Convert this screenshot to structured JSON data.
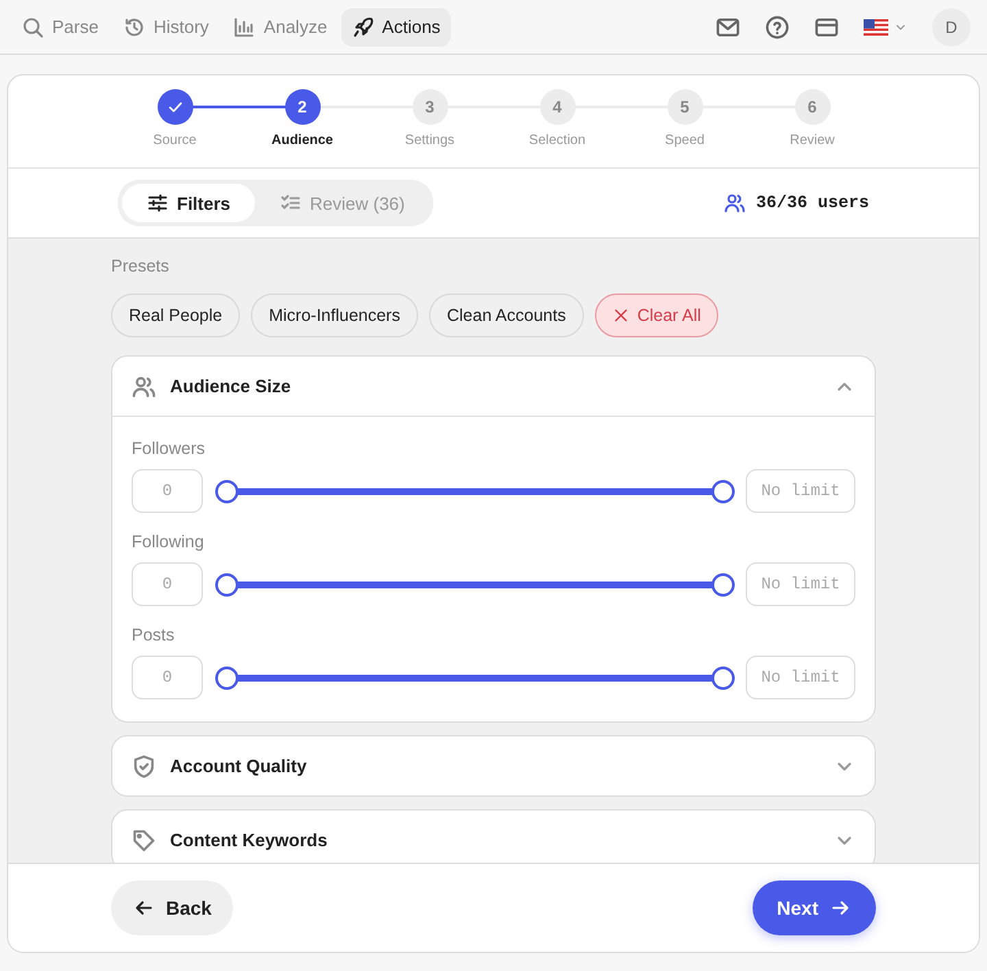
{
  "nav": {
    "items": [
      {
        "label": "Parse",
        "selected": false
      },
      {
        "label": "History",
        "selected": false
      },
      {
        "label": "Analyze",
        "selected": false
      },
      {
        "label": "Actions",
        "selected": true
      }
    ],
    "avatar": "D"
  },
  "steps": [
    {
      "label": "Source",
      "completed": true,
      "selected": false
    },
    {
      "number": "2",
      "label": "Audience",
      "completed": false,
      "selected": true
    },
    {
      "number": "3",
      "label": "Settings",
      "completed": false,
      "selected": false
    },
    {
      "number": "4",
      "label": "Selection",
      "completed": false,
      "selected": false
    },
    {
      "number": "5",
      "label": "Speed",
      "completed": false,
      "selected": false
    },
    {
      "number": "6",
      "label": "Review",
      "completed": false,
      "selected": false
    }
  ],
  "view_tabs": [
    {
      "label": "Filters",
      "selected": true
    },
    {
      "label": "Review (36)",
      "selected": false
    }
  ],
  "user_count": "36/36 users",
  "presets": {
    "title": "Presets",
    "items": [
      {
        "label": "Real People",
        "kind": "preset"
      },
      {
        "label": "Micro-Influencers",
        "kind": "preset"
      },
      {
        "label": "Clean Accounts",
        "kind": "preset"
      },
      {
        "label": "Clear All",
        "kind": "clear"
      }
    ]
  },
  "sections": [
    {
      "title": "Audience Size",
      "expanded": true,
      "ranges": [
        {
          "label": "Followers",
          "min_placeholder": "0",
          "max_placeholder": "No limit",
          "thumbs": [
            {
              "level": 0
            },
            {
              "level": 1
            }
          ]
        },
        {
          "label": "Following",
          "min_placeholder": "0",
          "max_placeholder": "No limit",
          "thumbs": [
            {
              "level": 0
            },
            {
              "level": 1
            }
          ]
        },
        {
          "label": "Posts",
          "min_placeholder": "0",
          "max_placeholder": "No limit",
          "thumbs": [
            {
              "level": 0
            },
            {
              "level": 1
            }
          ]
        }
      ]
    },
    {
      "title": "Account Quality",
      "expanded": false
    },
    {
      "title": "Content Keywords",
      "expanded": false
    }
  ],
  "footer": {
    "back": "Back",
    "next": "Next"
  }
}
